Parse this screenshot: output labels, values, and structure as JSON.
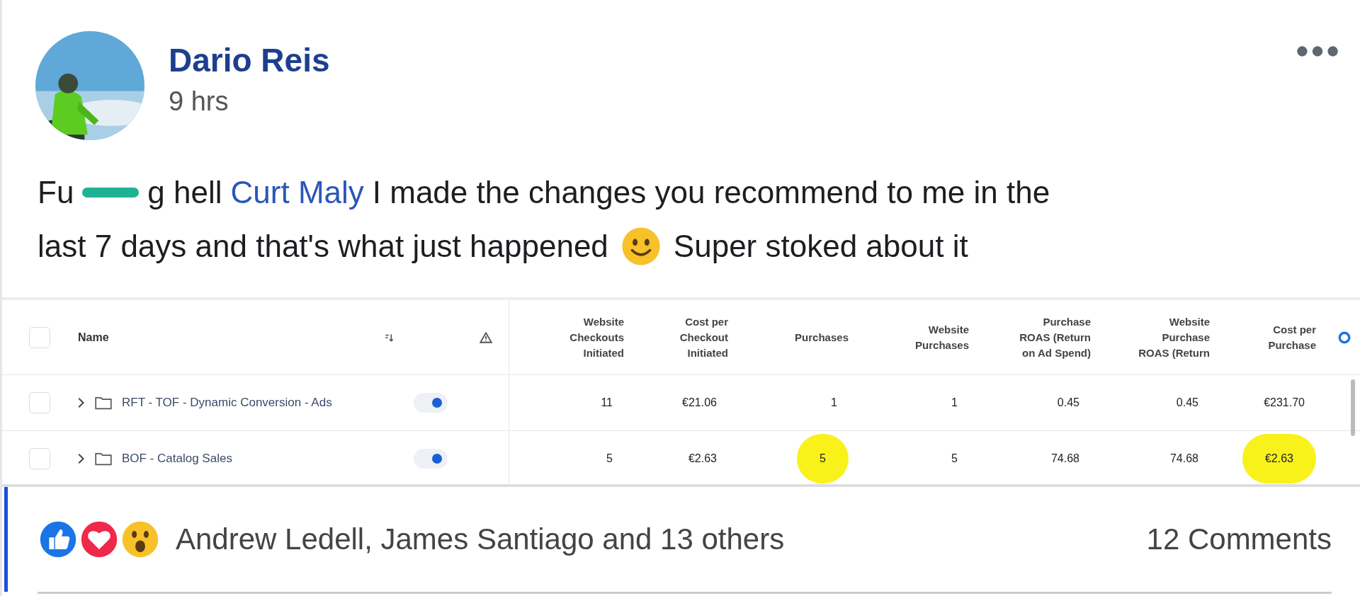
{
  "post": {
    "author": "Dario Reis",
    "time": "9 hrs",
    "text_before_mark": "Fu",
    "text_after_mark": "g hell",
    "mention": "Curt Maly",
    "text_line1": "I made the changes you recommend to me in the",
    "text_line2": "last 7 days and that's what just happened",
    "text_end": "Super stoked about it"
  },
  "table": {
    "all_checked": false,
    "name_column": "Name",
    "metric_columns": [
      "Website Checkouts Initiated",
      "Cost per Checkout Initiated",
      "Purchases",
      "Website Purchases",
      "Purchase ROAS (Return on Ad Spend)",
      "Website Purchase ROAS (Return",
      "Cost per Purchase"
    ],
    "rows": [
      {
        "checked": false,
        "name": "RFT - TOF - Dynamic Conversion - Ads",
        "on": true,
        "cells": [
          {
            "text": "11",
            "highlighted": false
          },
          {
            "text": "€21.06",
            "highlighted": false
          },
          {
            "text": "1",
            "highlighted": false
          },
          {
            "text": "1",
            "highlighted": false
          },
          {
            "text": "0.45",
            "highlighted": false
          },
          {
            "text": "0.45",
            "highlighted": false
          },
          {
            "text": "€231.70",
            "highlighted": false
          }
        ]
      },
      {
        "checked": false,
        "name": "BOF - Catalog Sales",
        "on": true,
        "cells": [
          {
            "text": "5",
            "highlighted": false
          },
          {
            "text": "€2.63",
            "highlighted": false
          },
          {
            "text": "5",
            "highlighted": true
          },
          {
            "text": "5",
            "highlighted": false
          },
          {
            "text": "74.68",
            "highlighted": false
          },
          {
            "text": "74.68",
            "highlighted": false
          },
          {
            "text": "€2.63",
            "highlighted": true
          }
        ]
      }
    ]
  },
  "reactions": {
    "names": "Andrew Ledell, James Santiago and 13 others",
    "comments": "12 Comments"
  }
}
